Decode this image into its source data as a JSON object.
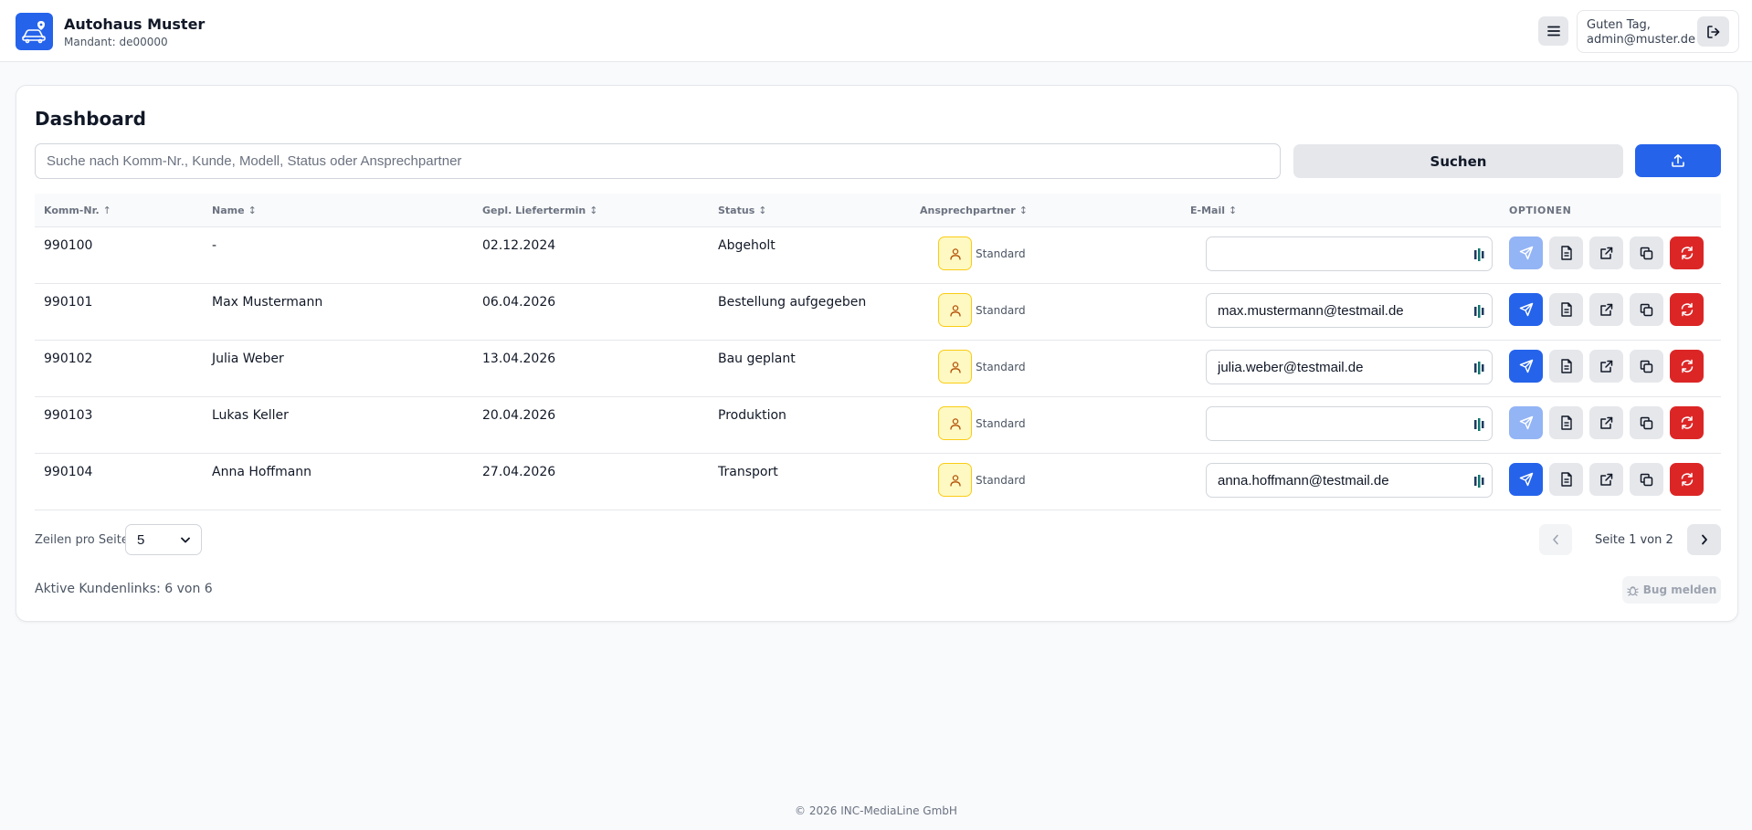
{
  "header": {
    "brand": "Autohaus Muster",
    "tenant": "Mandant: de00000",
    "greeting": "Guten Tag,",
    "user": "admin@muster.de"
  },
  "dashboard": {
    "title": "Dashboard",
    "search_placeholder": "Suche nach Komm-Nr., Kunde, Modell, Status oder Ansprechpartner",
    "search_value": "",
    "search_button": "Suchen"
  },
  "table": {
    "columns": [
      "Komm-Nr.",
      "Name",
      "Gepl. Liefertermin",
      "Status",
      "Ansprechpartner",
      "E-Mail",
      "OPTIONEN"
    ],
    "sort_indicators": [
      "↑",
      "↕",
      "↕",
      "↕",
      "↕",
      "↕",
      ""
    ],
    "rows": [
      {
        "komm_nr": "990100",
        "name": "-",
        "liefertermin": "02.12.2024",
        "status": "Abgeholt",
        "ansprechpartner": "Standard",
        "email": ""
      },
      {
        "komm_nr": "990101",
        "name": "Max Mustermann",
        "liefertermin": "06.04.2026",
        "status": "Bestellung aufgegeben",
        "ansprechpartner": "Standard",
        "email": "max.mustermann@testmail.de"
      },
      {
        "komm_nr": "990102",
        "name": "Julia Weber",
        "liefertermin": "13.04.2026",
        "status": "Bau geplant",
        "ansprechpartner": "Standard",
        "email": "julia.weber@testmail.de"
      },
      {
        "komm_nr": "990103",
        "name": "Lukas Keller",
        "liefertermin": "20.04.2026",
        "status": "Produktion",
        "ansprechpartner": "Standard",
        "email": ""
      },
      {
        "komm_nr": "990104",
        "name": "Anna Hoffmann",
        "liefertermin": "27.04.2026",
        "status": "Transport",
        "ansprechpartner": "Standard",
        "email": "anna.hoffmann@testmail.de"
      }
    ]
  },
  "pagination": {
    "rows_per_page_label": "Zeilen pro Seite",
    "rows_per_page_value": "5",
    "page_info": "Seite 1 von 2"
  },
  "footer": {
    "active_links": "Aktive Kundenlinks: 6 von 6",
    "bug_button": "Bug melden",
    "copyright": "© 2026 INC-MediaLine GmbH"
  },
  "icons": {
    "logo": "car-location-icon",
    "menu": "menu-icon",
    "logout": "logout-icon",
    "upload": "upload-icon",
    "contact": "user-icon",
    "send": "send-icon",
    "document": "document-icon",
    "external": "external-link-icon",
    "copy": "copy-icon",
    "reset": "refresh-icon",
    "bug": "bug-icon"
  },
  "colors": {
    "primary": "#2563eb",
    "primary_disabled": "#93b4f5",
    "danger": "#dc2626",
    "contact_badge_bg": "#fef9c3",
    "contact_badge_border": "#facc15"
  }
}
